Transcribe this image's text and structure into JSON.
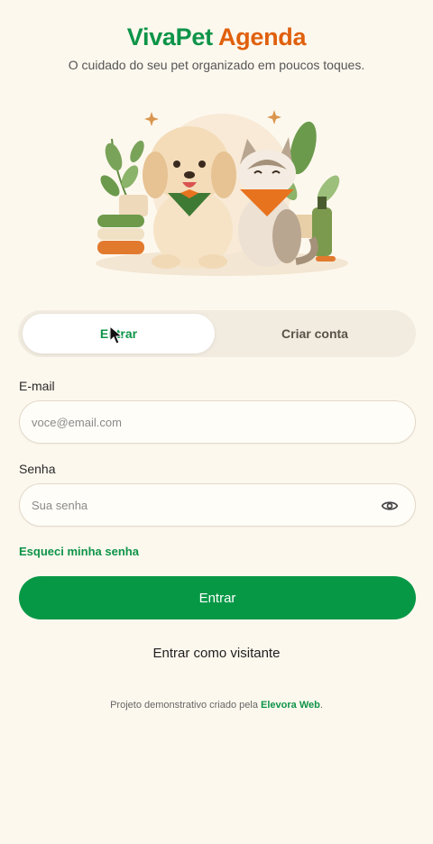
{
  "brand": {
    "part1": "VivaPet",
    "part2": "Agenda"
  },
  "tagline": "O cuidado do seu pet organizado em poucos toques.",
  "tabs": {
    "login": "Entrar",
    "signup": "Criar conta"
  },
  "form": {
    "email_label": "E-mail",
    "email_placeholder": "voce@email.com",
    "password_label": "Senha",
    "password_placeholder": "Sua senha",
    "forgot": "Esqueci minha senha",
    "submit": "Entrar",
    "guest": "Entrar como visitante"
  },
  "footer": {
    "prefix": "Projeto demonstrativo criado pela",
    "link": "Elevora Web",
    "suffix": "."
  },
  "colors": {
    "green": "#0d9448",
    "orange": "#e0600c",
    "background": "#fdf8ee"
  },
  "icons": {
    "password_toggle": "eye-icon"
  }
}
